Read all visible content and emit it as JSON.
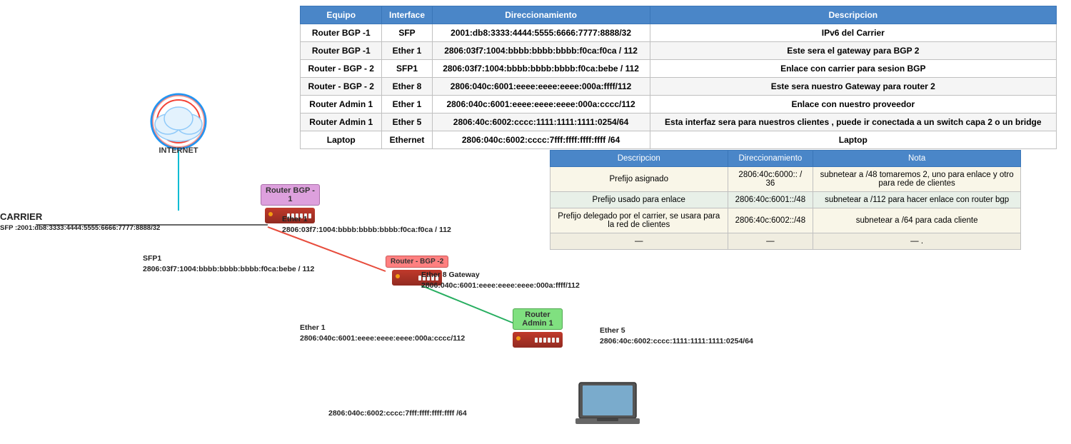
{
  "mainTable": {
    "headers": [
      "Equipo",
      "Interface",
      "Direccionamiento",
      "Descripcion"
    ],
    "rows": [
      {
        "equipo": "Router BGP -1",
        "interface": "SFP",
        "direccionamiento": "2001:db8:3333:4444:5555:6666:7777:8888/32",
        "descripcion": "IPv6 del Carrier"
      },
      {
        "equipo": "Router BGP -1",
        "interface": "Ether 1",
        "direccionamiento": "2806:03f7:1004:bbbb:bbbb:bbbb:f0ca:f0ca / 112",
        "descripcion": "Este sera el gateway para BGP 2"
      },
      {
        "equipo": "Router - BGP - 2",
        "interface": "SFP1",
        "direccionamiento": "2806:03f7:1004:bbbb:bbbb:bbbb:f0ca:bebe / 112",
        "descripcion": "Enlace con carrier para sesion BGP"
      },
      {
        "equipo": "Router - BGP - 2",
        "interface": "Ether 8",
        "direccionamiento": "2806:040c:6001:eeee:eeee:eeee:000a:ffff/112",
        "descripcion": "Este sera nuestro Gateway para router 2"
      },
      {
        "equipo": "Router Admin 1",
        "interface": "Ether 1",
        "direccionamiento": "2806:040c:6001:eeee:eeee:eeee:000a:cccc/112",
        "descripcion": "Enlace con nuestro proveedor"
      },
      {
        "equipo": "Router Admin 1",
        "interface": "Ether 5",
        "direccionamiento": "2806:40c:6002:cccc:1111:1111:1111:0254/64",
        "descripcion": "Esta interfaz sera para nuestros clientes , puede ir conectada a un switch capa 2 o un bridge"
      },
      {
        "equipo": "Laptop",
        "interface": "Ethernet",
        "direccionamiento": "2806:040c:6002:cccc:7fff:ffff:ffff:ffff /64",
        "descripcion": "Laptop"
      }
    ]
  },
  "secondaryTable": {
    "headers": [
      "Descripcion",
      "Direccionamiento",
      "Nota"
    ],
    "rows": [
      {
        "descripcion": "Prefijo asignado",
        "direccionamiento": "2806:40c:6000:: / 36",
        "nota": "subnetear a /48  tomaremos 2, uno para enlace y otro para rede de clientes"
      },
      {
        "descripcion": "Prefijo usado para enlace",
        "direccionamiento": "2806:40c:6001::/48",
        "nota": "subnetear a /112 para hacer enlace con router bgp"
      },
      {
        "descripcion": "Prefijo delegado por el carrier, se usara para la red de clientes",
        "direccionamiento": "2806:40c:6002::/48",
        "nota": "subnetear a /64 para cada cliente"
      },
      {
        "descripcion": "—",
        "direccionamiento": "—",
        "nota": "—  ."
      }
    ]
  },
  "diagram": {
    "internet_label": "INTERNET",
    "carrier_label": "CARRIER",
    "carrier_sfp": "SFP :2001:db8:3333:4444:5555:6666:7777:8888/32",
    "router_bgp1_label": "Router BGP -\n1",
    "router_bgp1_ether1": "Ether 1",
    "router_bgp1_addr1": "2806:03f7:1004:bbbb:bbbb:bbbb:f0ca:f0ca / 112",
    "router_bgp2_label": "Router - BGP -2",
    "router_bgp2_sfp1": "SFP1",
    "router_bgp2_addr1": "2806:03f7:1004:bbbb:bbbb:bbbb:f0ca:bebe / 112",
    "router_bgp2_ether8": "Ether 8 Gateway",
    "router_bgp2_addr2": "2806:040c:6001:eeee:eeee:eeee:000a:ffff/112",
    "router_admin1_label": "Router Admin 1",
    "router_admin1_ether1": "Ether 1",
    "router_admin1_addr1": "2806:040c:6001:eeee:eeee:eeee:000a:cccc/112",
    "router_admin1_ether5": "Ether 5",
    "router_admin1_addr2": "2806:40c:6002:cccc:1111:1111:1111:0254/64",
    "laptop_addr": "2806:040c:6002:cccc:7fff:ffff:ffff:ffff /64"
  }
}
